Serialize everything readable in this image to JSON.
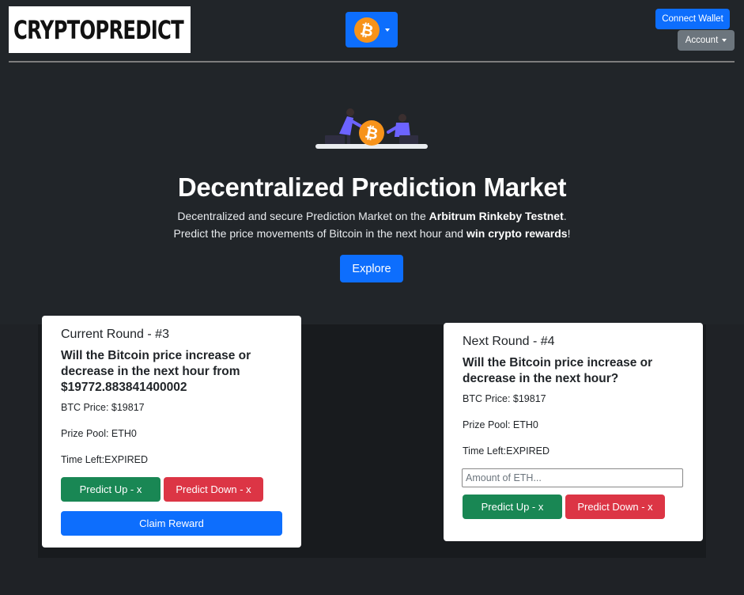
{
  "header": {
    "logo_text": "CRYPTOPREDICT",
    "coin_icon": "bitcoin-icon",
    "connect_wallet_label": "Connect Wallet",
    "account_label": "Account"
  },
  "hero": {
    "title": "Decentralized Prediction Market",
    "line1_prefix": "Decentralized and secure Prediction Market on the ",
    "line1_bold": "Arbitrum Rinkeby Testnet",
    "line1_suffix": ".",
    "line2_prefix": "Predict the price movements of Bitcoin in the next hour and ",
    "line2_bold": "win crypto rewards",
    "line2_suffix": "!",
    "explore_label": "Explore"
  },
  "current_round": {
    "title": "Current Round - #3",
    "question": "Will the Bitcoin price increase or decrease in the next hour from $19772.883841400002",
    "btc_price": "BTC Price: $19817",
    "prize_pool": "Prize Pool: ETH0",
    "time_left": "Time Left:EXPIRED",
    "predict_up_label": "Predict Up - x",
    "predict_down_label": "Predict Down - x",
    "claim_label": "Claim Reward"
  },
  "next_round": {
    "title": "Next Round - #4",
    "question": "Will the Bitcoin price increase or decrease in the next hour?",
    "btc_price": "BTC Price: $19817",
    "prize_pool": "Prize Pool: ETH0",
    "time_left": "Time Left:EXPIRED",
    "amount_placeholder": "Amount of ETH...",
    "predict_up_label": "Predict Up - x",
    "predict_down_label": "Predict Down - x"
  },
  "colors": {
    "primary": "#0d6efd",
    "success": "#198754",
    "danger": "#dc3545",
    "secondary": "#6c757d",
    "background": "#212529",
    "bitcoin": "#f7931a",
    "accent_purple": "#6c63ff"
  }
}
